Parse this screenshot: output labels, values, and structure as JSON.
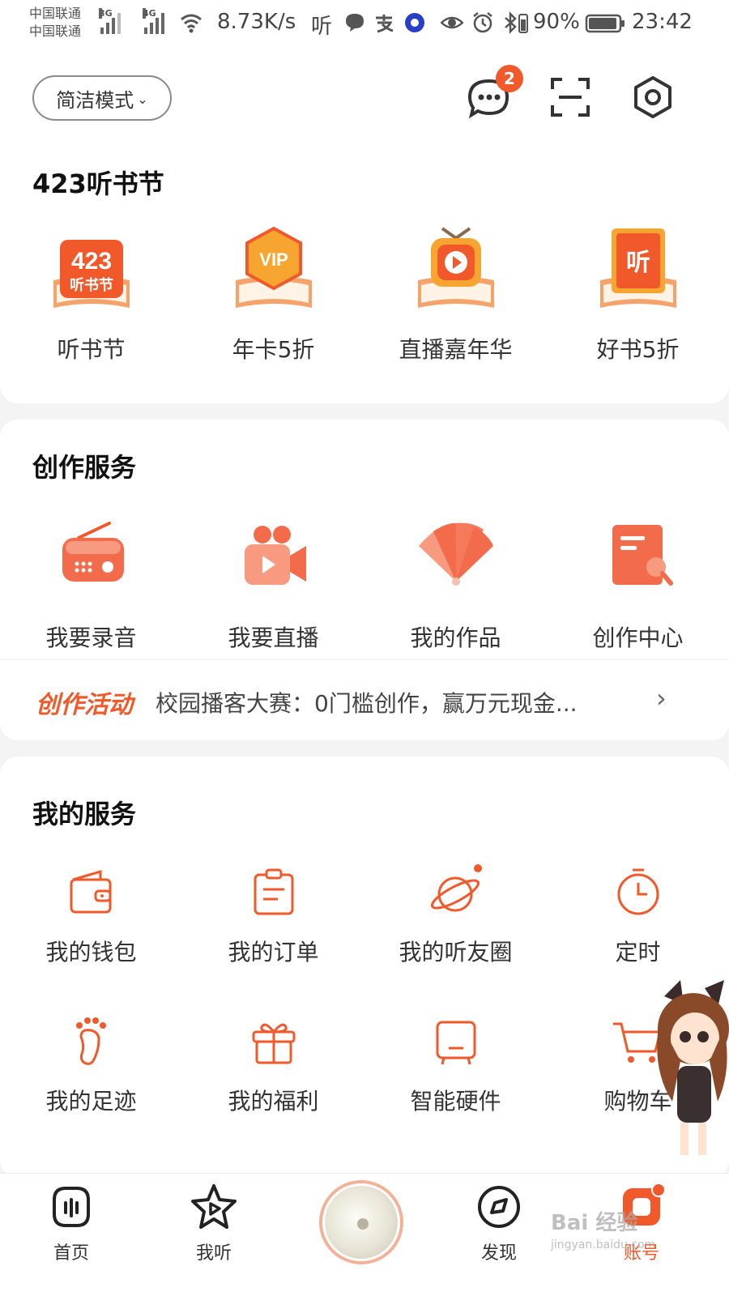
{
  "status_bar": {
    "carrier1": "中国联通",
    "carrier2": "中国联通",
    "net1": "3G",
    "net2": "4G",
    "speed": "8.73K/s",
    "app_char": "听",
    "battery": "90%",
    "time": "23:42"
  },
  "header": {
    "mode_label": "简洁模式",
    "message_badge": "2"
  },
  "festival": {
    "title": "423听书节",
    "items": [
      {
        "label": "听书节",
        "icon": "festival-423-icon"
      },
      {
        "label": "年卡5折",
        "icon": "vip-book-icon"
      },
      {
        "label": "直播嘉年华",
        "icon": "live-tv-icon"
      },
      {
        "label": "好书5折",
        "icon": "book-listen-icon"
      }
    ],
    "icon_text": {
      "num": "423",
      "sub": "听书节",
      "vip": "VIP",
      "listen": "听"
    }
  },
  "creation": {
    "title": "创作服务",
    "items": [
      {
        "label": "我要录音",
        "icon": "radio-icon"
      },
      {
        "label": "我要直播",
        "icon": "video-camera-icon"
      },
      {
        "label": "我的作品",
        "icon": "fan-icon"
      },
      {
        "label": "创作中心",
        "icon": "notepad-icon"
      }
    ],
    "banner_tag": "创作活动",
    "banner_text": "校园播客大赛：0门槛创作，赢万元现金...",
    "banner_arrow": "›"
  },
  "services": {
    "title": "我的服务",
    "row1": [
      {
        "label": "我的钱包",
        "icon": "wallet-icon"
      },
      {
        "label": "我的订单",
        "icon": "order-icon"
      },
      {
        "label": "我的听友圈",
        "icon": "planet-icon"
      },
      {
        "label": "定时",
        "icon": "timer-icon"
      }
    ],
    "row2": [
      {
        "label": "我的足迹",
        "icon": "footprint-icon"
      },
      {
        "label": "我的福利",
        "icon": "gift-icon"
      },
      {
        "label": "智能硬件",
        "icon": "smart-device-icon"
      },
      {
        "label": "购物车",
        "icon": "cart-icon"
      }
    ]
  },
  "tabbar": {
    "home": "首页",
    "listen": "我听",
    "discover": "发现",
    "account": "账号"
  },
  "watermark": {
    "main": "Bai 经验",
    "sub": "jingyan.baidu.com"
  },
  "colors": {
    "accent": "#f1592a",
    "icon_orange": "#f5a04a"
  }
}
